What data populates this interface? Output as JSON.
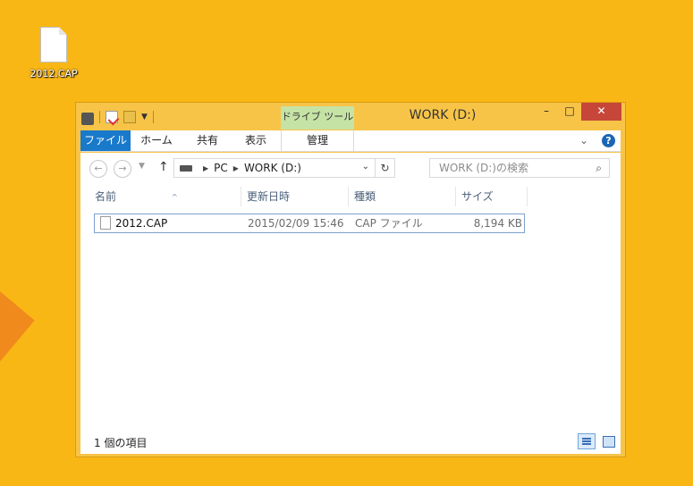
{
  "desktop": {
    "icon_label": "2012.CAP"
  },
  "window": {
    "title": "WORK (D:)",
    "context_tab_group": "ドライブ ツール",
    "controls": {
      "minimize": "–",
      "maximize": "□",
      "close": "✕"
    }
  },
  "ribbon": {
    "tabs": {
      "file": "ファイル",
      "home": "ホーム",
      "share": "共有",
      "view": "表示",
      "manage": "管理"
    },
    "expand_glyph": "⌄",
    "help_glyph": "?"
  },
  "navigation": {
    "back_glyph": "←",
    "forward_glyph": "→",
    "up_glyph": "↑",
    "path": [
      "PC",
      "WORK (D:)"
    ],
    "search_placeholder": "WORK (D:)の検索"
  },
  "file_list": {
    "columns": {
      "name": "名前",
      "date": "更新日時",
      "type": "種類",
      "size": "サイズ"
    },
    "rows": [
      {
        "name": "2012.CAP",
        "date": "2015/02/09 15:46",
        "type": "CAP ファイル",
        "size": "8,194 KB"
      }
    ]
  },
  "status_bar": {
    "item_count": "1 個の項目"
  },
  "colors": {
    "desktop": "#f9b716",
    "window_frame": "#f7c448",
    "file_tab": "#1979ca",
    "context_tab": "#c6e3a6",
    "close_button": "#c7463a"
  }
}
